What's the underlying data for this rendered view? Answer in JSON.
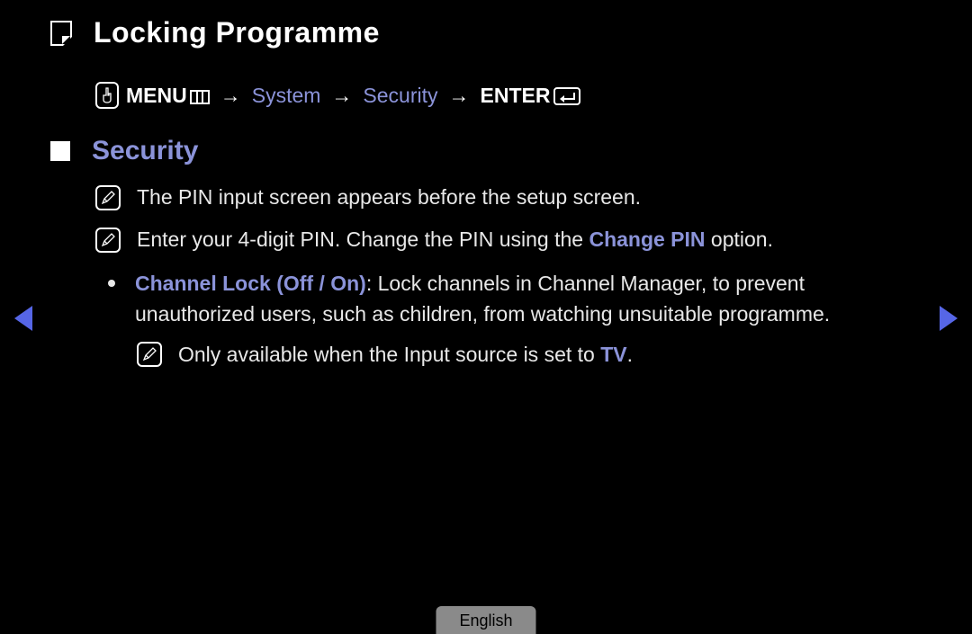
{
  "title": "Locking Programme",
  "breadcrumb": {
    "menu": "MENU",
    "system": "System",
    "security": "Security",
    "enter": "ENTER",
    "arrow": "→"
  },
  "section": {
    "heading": "Security",
    "note1": "The PIN input screen appears before the setup screen.",
    "note2_pre": "Enter your 4-digit PIN. Change the PIN using the ",
    "note2_highlight": "Change PIN",
    "note2_post": " option.",
    "bullet1_label": "Channel Lock (Off / On)",
    "bullet1_text": ": Lock channels in Channel Manager, to prevent unauthorized users, such as children, from watching unsuitable programme.",
    "subnote_pre": "Only available when the Input source is set to ",
    "subnote_highlight": "TV",
    "subnote_post": "."
  },
  "language": "English"
}
